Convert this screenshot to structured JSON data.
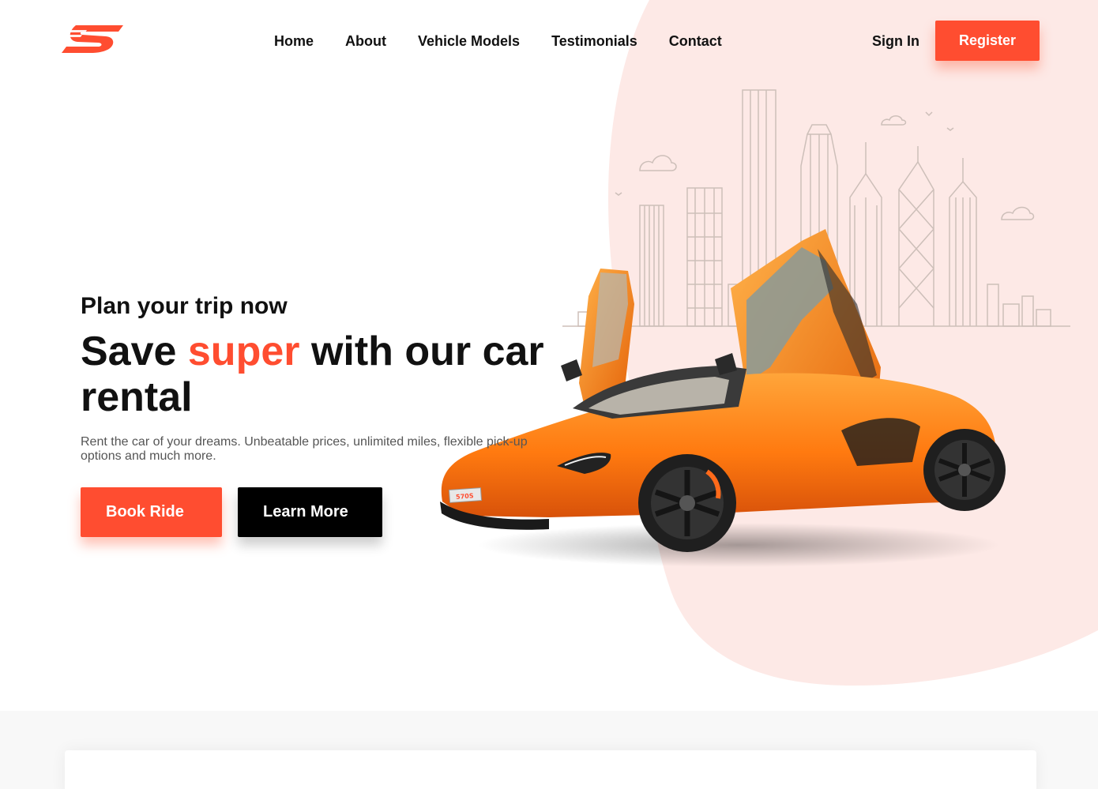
{
  "colors": {
    "accent": "#ff4d30",
    "blob": "#fde9e6",
    "dark": "#000000",
    "text": "#111111",
    "muted": "#555555"
  },
  "header": {
    "logo_icon": "speed-s-logo-icon",
    "nav": [
      "Home",
      "About",
      "Vehicle Models",
      "Testimonials",
      "Contact"
    ],
    "sign_in": "Sign In",
    "register": "Register"
  },
  "hero": {
    "subtitle": "Plan your trip now",
    "title_before": "Save ",
    "title_accent": "super",
    "title_after": " with our car rental",
    "description": "Rent the car of your dreams. Unbeatable prices, unlimited miles, flexible pick-up options and much more.",
    "book_button": "Book Ride",
    "learn_button": "Learn More",
    "car_plate": "570S",
    "city_icon": "city-skyline-icon"
  }
}
